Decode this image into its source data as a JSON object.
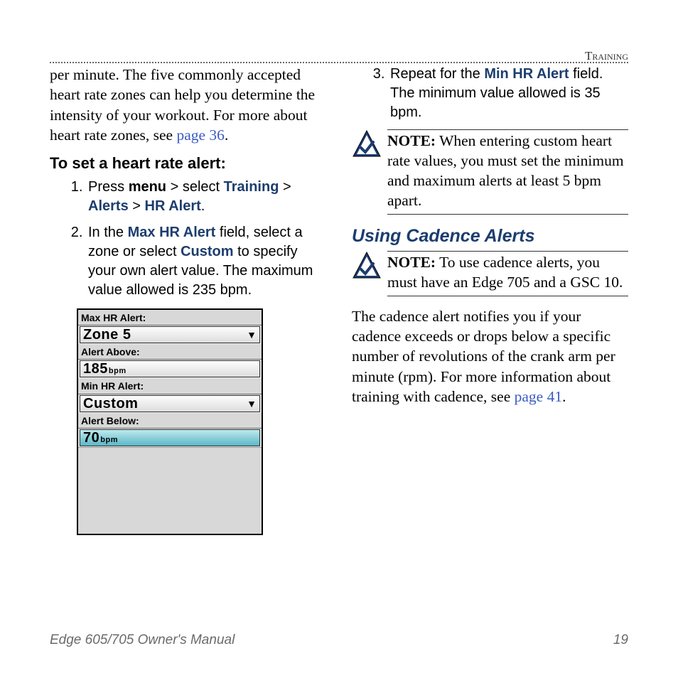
{
  "header": {
    "section": "Training"
  },
  "left": {
    "intro_a": "per minute. The five commonly accepted heart rate zones can help you determine the intensity of your workout. For more about heart rate zones, see ",
    "intro_link": "page 36",
    "intro_b": ".",
    "proc_heading": "To set a heart rate alert:",
    "step1_a": "Press ",
    "step1_menu": "menu",
    "step1_b": " > select ",
    "step1_training": "Training",
    "step1_c": " > ",
    "step1_alerts": "Alerts",
    "step1_d": " > ",
    "step1_hralert": "HR Alert",
    "step1_e": ".",
    "step2_a": "In the ",
    "step2_max": "Max HR Alert",
    "step2_b": " field, select a zone or select ",
    "step2_custom": "Custom",
    "step2_c": " to specify your own alert value. The maximum value allowed is 235 bpm."
  },
  "device": {
    "lbl_max": "Max HR Alert:",
    "val_max": "Zone 5",
    "lbl_above": "Alert Above:",
    "val_above": "185",
    "unit": "bpm",
    "lbl_min": "Min HR Alert:",
    "val_min": "Custom",
    "lbl_below": "Alert Below:",
    "val_below": "70"
  },
  "right": {
    "step3_a": "Repeat for the ",
    "step3_min": "Min HR Alert",
    "step3_b": " field. The minimum value allowed is 35 bpm.",
    "note1_lbl": "NOTE:",
    "note1_txt": " When entering custom heart rate values, you must set the minimum and maximum alerts at least 5 bpm apart.",
    "section": "Using Cadence Alerts",
    "note2_lbl": "NOTE:",
    "note2_txt": " To use cadence alerts, you must have an Edge 705 and a GSC 10.",
    "body_a": "The cadence alert notifies you if your cadence exceeds or drops below a specific number of revolutions of the crank arm per minute (rpm). For more information about training with cadence, see ",
    "body_link": "page 41",
    "body_b": "."
  },
  "footer": {
    "title": "Edge 605/705 Owner's Manual",
    "page": "19"
  }
}
